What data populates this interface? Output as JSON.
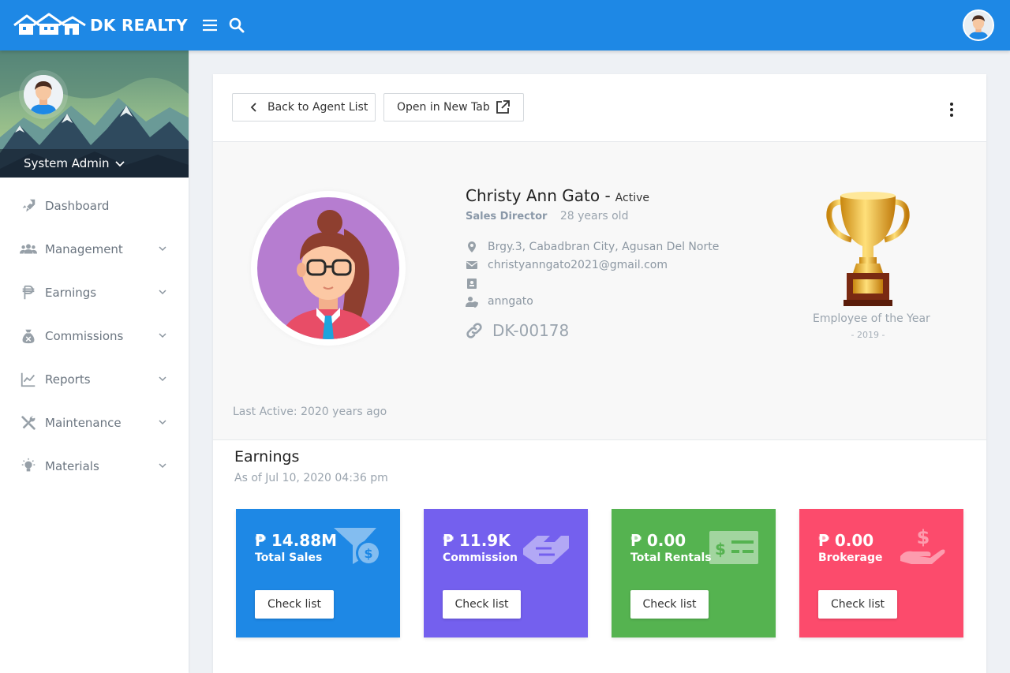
{
  "header": {
    "brand": "DK REALTY",
    "icons": {
      "menu": "hamburger-menu-icon",
      "search": "search-icon"
    }
  },
  "sidebar": {
    "user_name": "System Admin",
    "items": [
      {
        "label": "Dashboard",
        "icon": "rocket-icon",
        "expandable": false
      },
      {
        "label": "Management",
        "icon": "users-icon",
        "expandable": true
      },
      {
        "label": "Earnings",
        "icon": "peso-icon",
        "expandable": true
      },
      {
        "label": "Commissions",
        "icon": "money-bag-icon",
        "expandable": true
      },
      {
        "label": "Reports",
        "icon": "chart-line-icon",
        "expandable": true
      },
      {
        "label": "Maintenance",
        "icon": "tools-icon",
        "expandable": true
      },
      {
        "label": "Materials",
        "icon": "lightbulb-icon",
        "expandable": true
      }
    ]
  },
  "toolbar": {
    "back_label": "Back to Agent List",
    "open_label": "Open in New Tab"
  },
  "profile": {
    "name": "Christy Ann Gato -",
    "status": "Active",
    "role": "Sales Director",
    "age": "28 years old",
    "address": "Brgy.3, Cabadbran City, Agusan Del Norte",
    "email": "christyanngato2021@gmail.com",
    "id_value": "",
    "username": "anngato",
    "agent_code": "DK-00178",
    "award": "Employee of the Year",
    "award_year": "- 2019 -",
    "last_active": "Last Active: 2020 years ago"
  },
  "earnings": {
    "title": "Earnings",
    "subtitle": "As of Jul 10, 2020 04:36 pm",
    "cards": [
      {
        "amount": "₱ 14.88M",
        "label": "Total Sales",
        "button": "Check list",
        "color": "#1e88e5",
        "icon": "funnel-dollar-icon"
      },
      {
        "amount": "₱ 11.9K",
        "label": "Commission",
        "button": "Check list",
        "color": "#7460ee",
        "icon": "handshake-icon"
      },
      {
        "amount": "₱ 0.00",
        "label": "Total Rentals",
        "button": "Check list",
        "color": "#55b350",
        "icon": "money-check-icon"
      },
      {
        "amount": "₱ 0.00",
        "label": "Brokerage",
        "button": "Check list",
        "color": "#fc4b6c",
        "icon": "hand-holding-dollar-icon"
      }
    ]
  }
}
